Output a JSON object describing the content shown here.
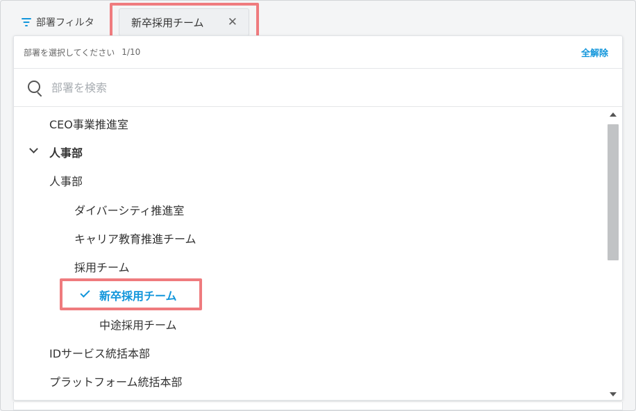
{
  "filter": {
    "label": "部署フィルタ",
    "accent_color": "#1296db"
  },
  "chip": {
    "label": "新卒採用チーム",
    "close_glyph": "✕"
  },
  "panel": {
    "hint": "部署を選択してください",
    "count": "1/10",
    "clear_all": "全解除"
  },
  "search": {
    "placeholder": "部署を検索",
    "value": ""
  },
  "tree": [
    {
      "label": "CEO事業推進室",
      "level": 0,
      "expanded": false,
      "selected": false
    },
    {
      "label": "人事部",
      "level": 0,
      "expanded": true,
      "selected": false,
      "has_children": true
    },
    {
      "label": "人事部",
      "level": 1,
      "selected": false
    },
    {
      "label": "ダイバーシティ推進室",
      "level": 2,
      "selected": false
    },
    {
      "label": "キャリア教育推進チーム",
      "level": 2,
      "selected": false
    },
    {
      "label": "採用チーム",
      "level": 2,
      "selected": false
    },
    {
      "label": "新卒採用チーム",
      "level": 3,
      "selected": true
    },
    {
      "label": "中途採用チーム",
      "level": 3,
      "selected": false
    },
    {
      "label": "IDサービス統括本部",
      "level": 1,
      "selected": false
    },
    {
      "label": "プラットフォーム統括本部",
      "level": 1,
      "selected": false
    }
  ],
  "colors": {
    "highlight": "#ef7b7e",
    "selected_text": "#1296db"
  }
}
